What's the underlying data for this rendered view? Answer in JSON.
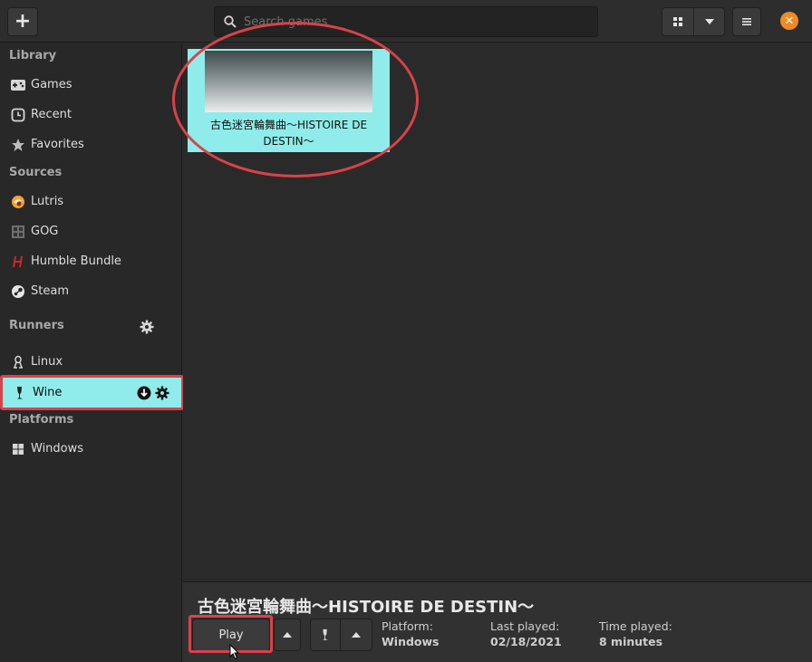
{
  "header": {
    "add_label": "+",
    "search_placeholder": "Search games",
    "close_label": "✕"
  },
  "sidebar": {
    "library_title": "Library",
    "library_items": [
      {
        "label": "Games",
        "icon": "gamepad-icon"
      },
      {
        "label": "Recent",
        "icon": "clock-icon"
      },
      {
        "label": "Favorites",
        "icon": "star-icon"
      }
    ],
    "sources_title": "Sources",
    "source_items": [
      {
        "label": "Lutris",
        "icon": "lutris-icon"
      },
      {
        "label": "GOG",
        "icon": "gog-icon"
      },
      {
        "label": "Humble Bundle",
        "icon": "humble-icon"
      },
      {
        "label": "Steam",
        "icon": "steam-icon"
      }
    ],
    "runners_title": "Runners",
    "runner_items": [
      {
        "label": "Linux",
        "icon": "linux-icon"
      },
      {
        "label": "Wine",
        "icon": "wine-icon",
        "selected": true
      }
    ],
    "platforms_title": "Platforms",
    "platform_items": [
      {
        "label": "Windows",
        "icon": "windows-icon"
      }
    ]
  },
  "games": [
    {
      "title": "古色迷宮輪舞曲〜HISTOIRE DE DESTIN〜"
    }
  ],
  "bottom": {
    "game_title": "古色迷宮輪舞曲〜HISTOIRE DE DESTIN〜",
    "play_label": "Play",
    "platform_label": "Platform:",
    "platform_value": "Windows",
    "last_played_label": "Last played:",
    "last_played_value": "02/18/2021",
    "time_played_label": "Time played:",
    "time_played_value": "8 minutes"
  },
  "colors": {
    "accent": "#8fecea",
    "highlight": "#d9424a",
    "close": "#f08a24"
  }
}
